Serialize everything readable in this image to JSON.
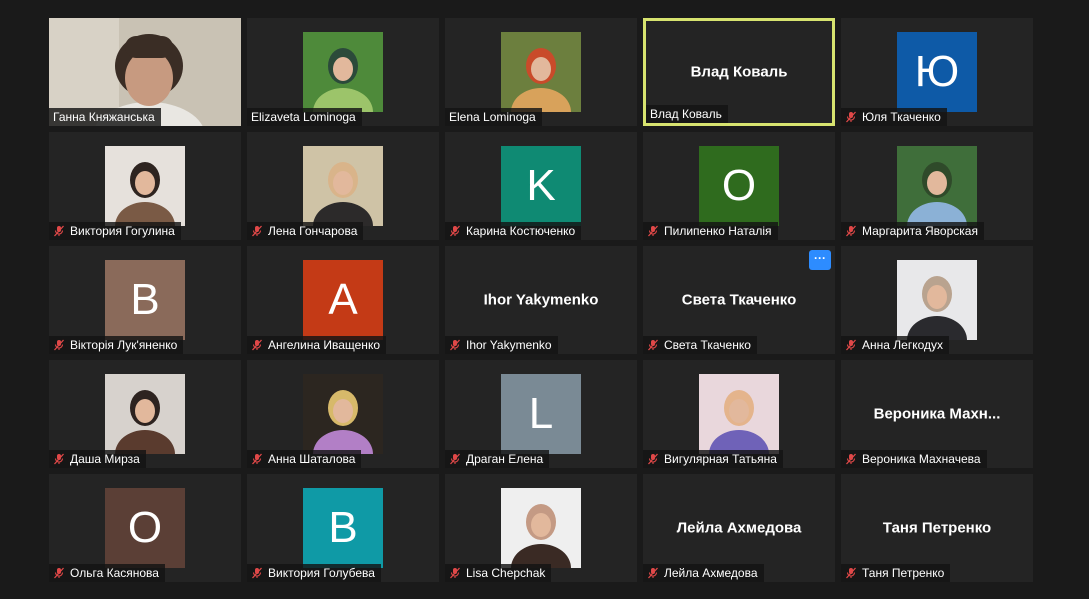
{
  "meeting": {
    "participants": [
      {
        "name": "Ганна Княжанська",
        "kind": "video",
        "muted": false,
        "palette": [
          "#c9c2b4",
          "#6b5a4c",
          "#3a2d25"
        ]
      },
      {
        "name": "Elizaveta Lominoga",
        "kind": "photo",
        "muted": false,
        "palette": [
          "#4e8a3a",
          "#9cc46a",
          "#2b4a3a"
        ]
      },
      {
        "name": "Elena Lominoga",
        "kind": "photo",
        "muted": false,
        "palette": [
          "#6c7f3e",
          "#d8a25b",
          "#c94b2a"
        ]
      },
      {
        "name": "Влад Коваль",
        "kind": "name",
        "muted": false,
        "active": true
      },
      {
        "name": "Юля Ткаченко",
        "kind": "avatar",
        "initial": "Ю",
        "color": "#0e5aa7",
        "muted": true
      },
      {
        "name": "Виктория Гогулина",
        "kind": "photo",
        "muted": true,
        "palette": [
          "#e6e1dc",
          "#7a5a45",
          "#2e2420"
        ]
      },
      {
        "name": "Лена Гончарова",
        "kind": "photo",
        "muted": true,
        "palette": [
          "#cfc3a6",
          "#2c2a2a",
          "#d9b48a"
        ]
      },
      {
        "name": "Карина Костюченко",
        "kind": "avatar",
        "initial": "K",
        "color": "#0f8a73",
        "muted": true
      },
      {
        "name": "Пилипенко Наталія",
        "kind": "avatar",
        "initial": "O",
        "color": "#2f6b1e",
        "muted": true
      },
      {
        "name": "Маргарита Яворская",
        "kind": "photo",
        "muted": true,
        "palette": [
          "#3f6e3a",
          "#8bb1d6",
          "#2f4a2a"
        ]
      },
      {
        "name": "Вікторія Лук'яненко",
        "kind": "avatar",
        "initial": "B",
        "color": "#8a6a5a",
        "muted": true
      },
      {
        "name": "Ангелина Иващенко",
        "kind": "avatar",
        "initial": "A",
        "color": "#c43a16",
        "muted": true
      },
      {
        "name": "Ihor Yakymenko",
        "kind": "name",
        "muted": true
      },
      {
        "name": "Света Ткаченко",
        "kind": "name",
        "muted": true,
        "more_button": "···"
      },
      {
        "name": "Анна Легкодух",
        "kind": "photo",
        "muted": true,
        "palette": [
          "#e8e8ea",
          "#2a2a2e",
          "#b9a38f"
        ]
      },
      {
        "name": "Даша Мирза",
        "kind": "photo",
        "muted": true,
        "palette": [
          "#d7d2cd",
          "#5a3b2e",
          "#2d2320"
        ]
      },
      {
        "name": "Анна Шаталова",
        "kind": "photo",
        "muted": true,
        "palette": [
          "#2c2620",
          "#b27fc6",
          "#d7b96a"
        ]
      },
      {
        "name": "Драган Елена",
        "kind": "avatar",
        "initial": "L",
        "color": "#7a8a95",
        "muted": true
      },
      {
        "name": "Вигулярная Татьяна",
        "kind": "photo",
        "muted": true,
        "palette": [
          "#e9d7dc",
          "#6f62b8",
          "#e4b48c"
        ]
      },
      {
        "name": "Вероника Махначева",
        "kind": "name",
        "display_name": "Вероника  Махн...",
        "muted": true
      },
      {
        "name": "Ольга Касянова",
        "kind": "avatar",
        "initial": "O",
        "color": "#5b3f36",
        "muted": true
      },
      {
        "name": "Виктория Голубева",
        "kind": "avatar",
        "initial": "B",
        "color": "#0f9aa6",
        "muted": true
      },
      {
        "name": "Lisa Chepchak",
        "kind": "photo",
        "muted": true,
        "palette": [
          "#efefef",
          "#3a2a24",
          "#c49a84"
        ]
      },
      {
        "name": "Лейла Ахмедова",
        "kind": "name",
        "muted": true
      },
      {
        "name": "Таня Петренко",
        "kind": "name",
        "muted": true
      }
    ]
  }
}
